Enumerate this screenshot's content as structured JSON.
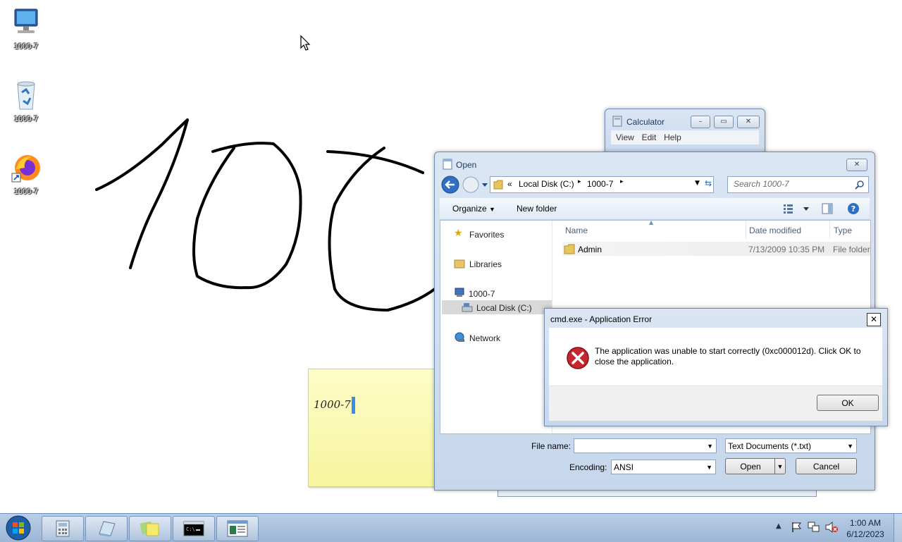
{
  "desktop": {
    "icons": [
      {
        "label": "1000-7",
        "icon": "computer-icon"
      },
      {
        "label": "1000-7",
        "icon": "recycle-bin-icon"
      },
      {
        "label": "1000-7",
        "icon": "firefox-shortcut-icon"
      }
    ]
  },
  "sticky_note": {
    "text": "1000-7"
  },
  "calculator": {
    "title": "Calculator",
    "menu": [
      "View",
      "Edit",
      "Help"
    ]
  },
  "open_dialog": {
    "title": "Open",
    "breadcrumb": [
      "«",
      "Local Disk (C:)",
      "1000-7"
    ],
    "search_placeholder": "Search 1000-7",
    "toolbar": {
      "organize": "Organize",
      "new_folder": "New folder"
    },
    "nav": {
      "favorites": "Favorites",
      "libraries": "Libraries",
      "computer": "1000-7",
      "local_disk": "Local Disk (C:)",
      "network": "Network"
    },
    "columns": {
      "name": "Name",
      "date_modified": "Date modified",
      "type": "Type"
    },
    "files": [
      {
        "name": "Admin",
        "date_modified": "7/13/2009 10:35 PM",
        "type": "File folder"
      }
    ],
    "file_name_label": "File name:",
    "file_name_value": "",
    "file_type_value": "Text Documents (*.txt)",
    "encoding_label": "Encoding:",
    "encoding_value": "ANSI",
    "open_button": "Open",
    "cancel_button": "Cancel"
  },
  "error_dialog": {
    "title": "cmd.exe - Application Error",
    "message": "The application was unable to start correctly (0xc000012d). Click OK to close the application.",
    "ok_button": "OK"
  },
  "taskbar": {
    "items": [
      "calculator-icon",
      "notepad-icon",
      "sticky-notes-icon",
      "cmd-icon",
      "window-icon"
    ],
    "clock_time": "1:00 AM",
    "clock_date": "6/12/2023"
  }
}
